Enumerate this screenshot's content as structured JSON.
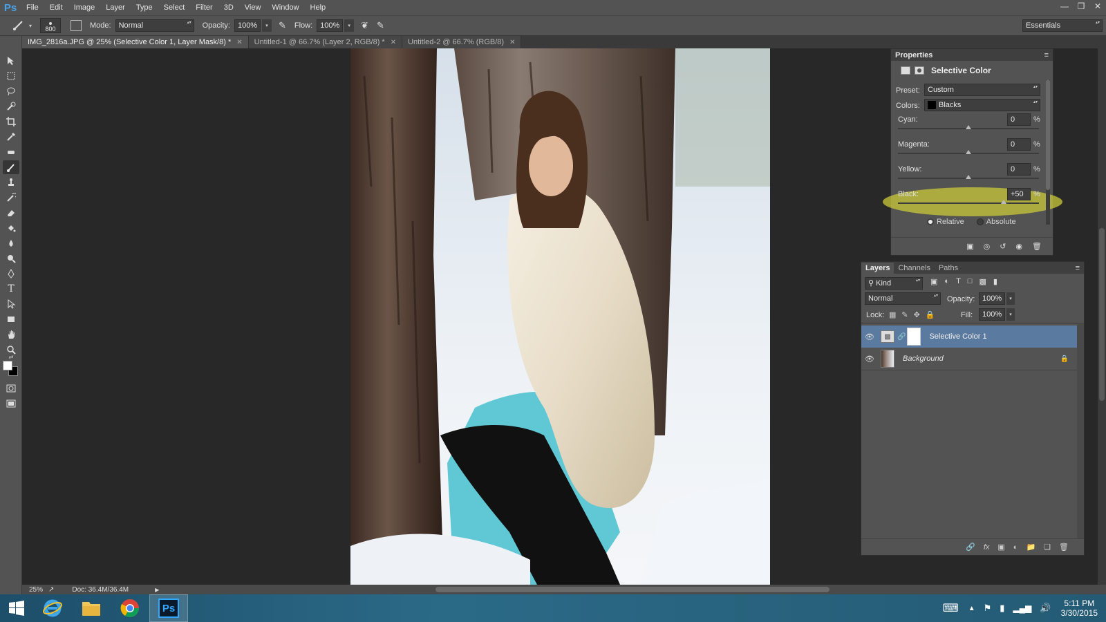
{
  "app": {
    "logo": "Ps",
    "menu": [
      "File",
      "Edit",
      "Image",
      "Layer",
      "Type",
      "Select",
      "Filter",
      "3D",
      "View",
      "Window",
      "Help"
    ]
  },
  "options": {
    "brush_size": "800",
    "mode_label": "Mode:",
    "mode_value": "Normal",
    "opacity_label": "Opacity:",
    "opacity_value": "100%",
    "flow_label": "Flow:",
    "flow_value": "100%",
    "workspace": "Essentials"
  },
  "tabs": [
    {
      "label": "IMG_2816a.JPG @ 25% (Selective Color 1, Layer Mask/8) *"
    },
    {
      "label": "Untitled-1 @ 66.7% (Layer 2, RGB/8) *"
    },
    {
      "label": "Untitled-2 @ 66.7% (RGB/8)"
    }
  ],
  "status": {
    "zoom": "25%",
    "doc": "Doc: 36.4M/36.4M"
  },
  "properties": {
    "title": "Properties",
    "adjustment": "Selective Color",
    "preset_label": "Preset:",
    "preset_value": "Custom",
    "colors_label": "Colors:",
    "colors_value": "Blacks",
    "sliders": [
      {
        "name": "Cyan:",
        "value": "0",
        "pct": "%",
        "level": 0
      },
      {
        "name": "Magenta:",
        "value": "0",
        "pct": "%",
        "level": 0
      },
      {
        "name": "Yellow:",
        "value": "0",
        "pct": "%",
        "level": 0
      },
      {
        "name": "Black:",
        "value": "+50",
        "pct": "%",
        "level": 50
      }
    ],
    "method_relative": "Relative",
    "method_absolute": "Absolute",
    "highlight_color": "#c8c83a"
  },
  "layers": {
    "tabs": [
      "Layers",
      "Channels",
      "Paths"
    ],
    "filter_kind": "Kind",
    "blend_mode": "Normal",
    "opacity_label": "Opacity:",
    "opacity_value": "100%",
    "lock_label": "Lock:",
    "fill_label": "Fill:",
    "fill_value": "100%",
    "items": [
      {
        "name": "Selective Color 1"
      },
      {
        "name": "Background"
      }
    ],
    "selected_color": "#5b7aa0"
  },
  "taskbar": {
    "time": "5:11 PM",
    "date": "3/30/2015",
    "ps_label": "Ps"
  }
}
